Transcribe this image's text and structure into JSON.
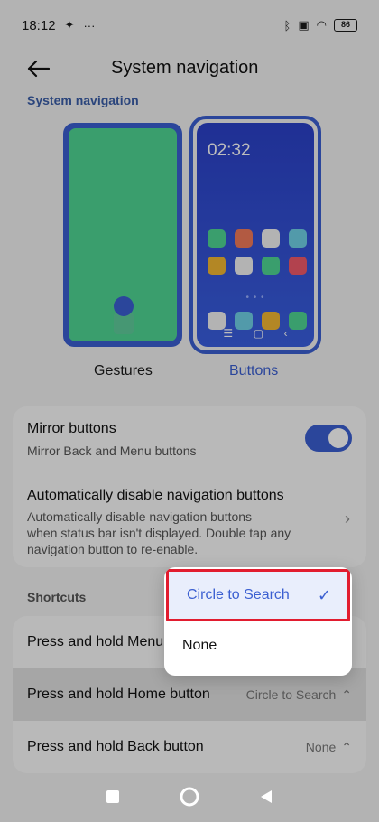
{
  "status_bar": {
    "time": "18:12",
    "extras": "···",
    "battery": "86"
  },
  "header": {
    "title": "System navigation"
  },
  "nav_section": {
    "label": "System navigation",
    "preview_time": "02:32",
    "modes": [
      {
        "label": "Gestures"
      },
      {
        "label": "Buttons",
        "selected": true
      }
    ]
  },
  "settings": {
    "mirror_title": "Mirror buttons",
    "mirror_sub": "Mirror Back and Menu buttons",
    "mirror_on": true,
    "auto_title": "Automatically disable navigation buttons",
    "auto_sub_1": "Automatically disable navigation buttons",
    "auto_sub_2": "when status bar isn't displayed. Double tap any",
    "auto_sub_3": "navigation button to re-enable."
  },
  "shortcuts": {
    "label": "Shortcuts",
    "rows": [
      {
        "title": "Press and hold Menu button",
        "value": ""
      },
      {
        "title": "Press and hold Home button",
        "value": "Circle to Search"
      },
      {
        "title": "Press and hold Back button",
        "value": "None"
      }
    ]
  },
  "popup": {
    "options": [
      {
        "label": "Circle to Search",
        "selected": true
      },
      {
        "label": "None"
      }
    ]
  },
  "colors": {
    "accent": "#3b5fd1",
    "gesture_green": "#4fd594",
    "highlight": "#e21c2f"
  }
}
